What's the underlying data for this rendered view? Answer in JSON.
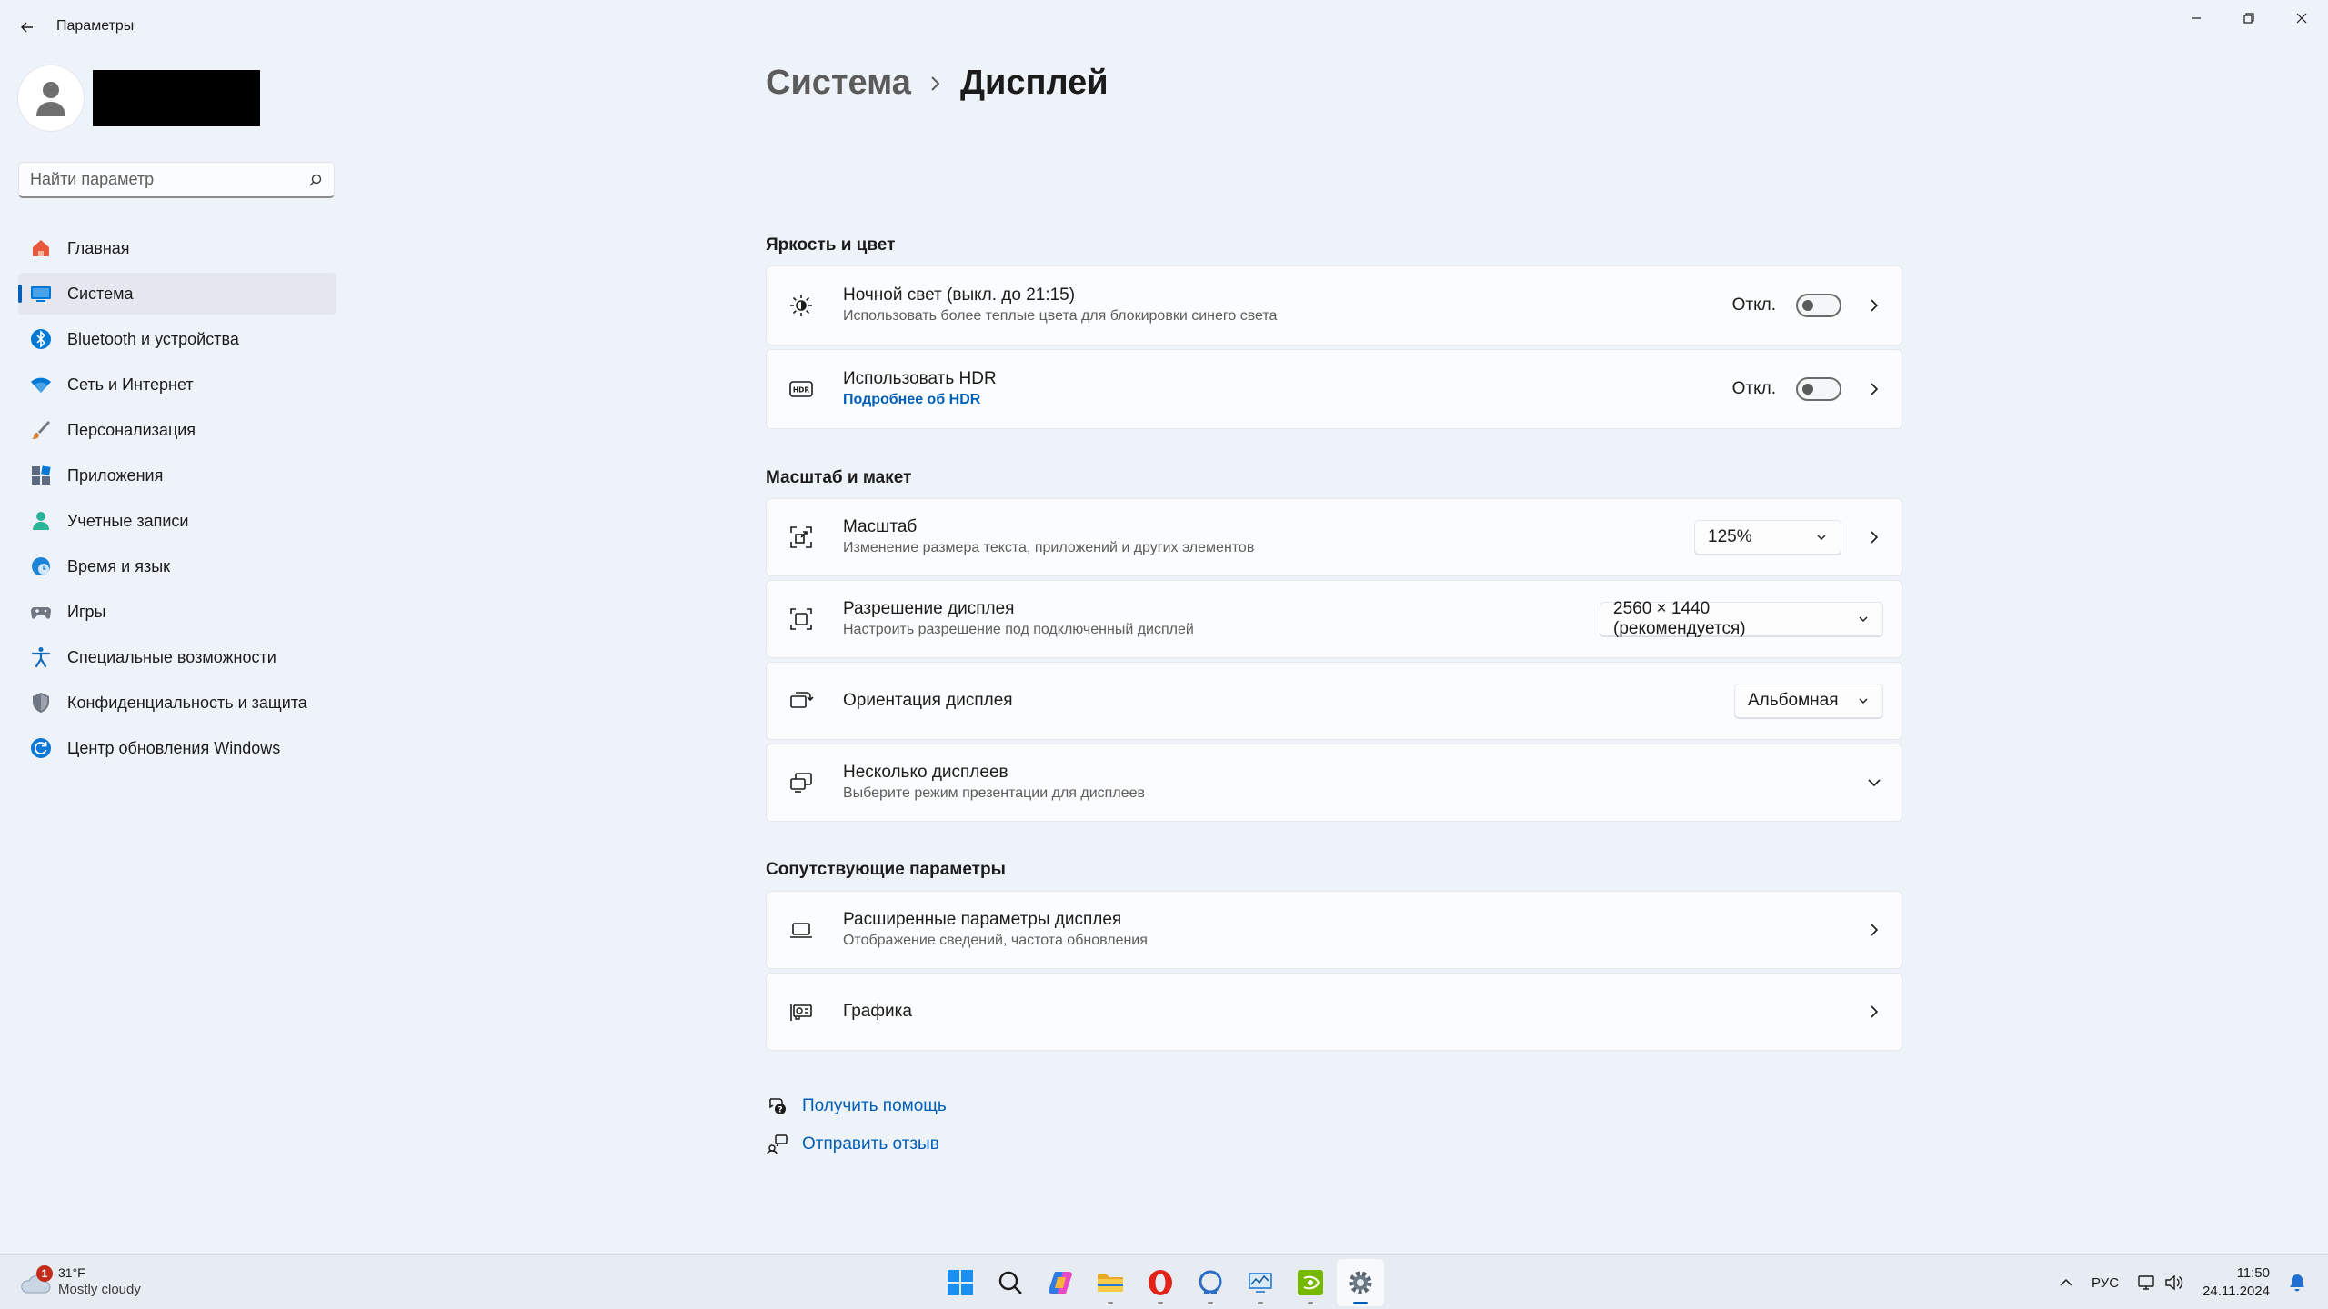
{
  "window": {
    "title": "Параметры",
    "back_icon": "arrow-left-icon",
    "controls": [
      "minimize-icon",
      "restore-icon",
      "close-icon"
    ]
  },
  "search": {
    "placeholder": "Найти параметр",
    "value": ""
  },
  "sidebar": {
    "items": [
      {
        "label": "Главная",
        "icon": "home-icon",
        "color": "#e8593b"
      },
      {
        "label": "Система",
        "icon": "monitor-icon",
        "color": "#0078d4",
        "active": true
      },
      {
        "label": "Bluetooth и устройства",
        "icon": "bluetooth-icon",
        "color": "#0078d4"
      },
      {
        "label": "Сеть и Интернет",
        "icon": "wifi-icon",
        "color": "#0078d4"
      },
      {
        "label": "Персонализация",
        "icon": "brush-icon",
        "color": "#d4823a"
      },
      {
        "label": "Приложения",
        "icon": "apps-icon",
        "color": "#5c6b82"
      },
      {
        "label": "Учетные записи",
        "icon": "person-icon",
        "color": "#2bb49a"
      },
      {
        "label": "Время и язык",
        "icon": "globe-clock-icon",
        "color": "#1b84d6"
      },
      {
        "label": "Игры",
        "icon": "gamepad-icon",
        "color": "#6f7782"
      },
      {
        "label": "Специальные возможности",
        "icon": "accessibility-icon",
        "color": "#0f6cbd"
      },
      {
        "label": "Конфиденциальность и защита",
        "icon": "shield-icon",
        "color": "#6f7782"
      },
      {
        "label": "Центр обновления Windows",
        "icon": "refresh-icon",
        "color": "#0f78d4"
      }
    ]
  },
  "breadcrumb": {
    "parent": "Система",
    "current": "Дисплей"
  },
  "sections": {
    "brightness": {
      "title": "Яркость и цвет",
      "night_light": {
        "title": "Ночной свет (выкл. до 21:15)",
        "subtitle": "Использовать более теплые цвета для блокировки синего света",
        "state": "Откл.",
        "on": false
      },
      "hdr": {
        "title": "Использовать HDR",
        "link": "Подробнее об HDR",
        "state": "Откл.",
        "on": false
      }
    },
    "scale_layout": {
      "title": "Масштаб и макет",
      "scale": {
        "title": "Масштаб",
        "subtitle": "Изменение размера текста, приложений и других элементов",
        "value": "125%"
      },
      "resolution": {
        "title": "Разрешение дисплея",
        "subtitle": "Настроить разрешение под подключенный дисплей",
        "value": "2560 × 1440 (рекомендуется)"
      },
      "orientation": {
        "title": "Ориентация дисплея",
        "value": "Альбомная"
      },
      "multiple": {
        "title": "Несколько дисплеев",
        "subtitle": "Выберите режим презентации для дисплеев"
      }
    },
    "related": {
      "title": "Сопутствующие параметры",
      "advanced": {
        "title": "Расширенные параметры дисплея",
        "subtitle": "Отображение сведений, частота обновления"
      },
      "graphics": {
        "title": "Графика"
      }
    }
  },
  "links": {
    "help": "Получить помощь",
    "feedback": "Отправить отзыв"
  },
  "taskbar": {
    "weather": {
      "temp": "31°F",
      "desc": "Mostly cloudy",
      "badge": "1"
    },
    "apps": [
      "windows-start-icon",
      "search-icon",
      "copilot-icon",
      "file-explorer-icon",
      "opera-icon",
      "app-icon",
      "monitor-chart-icon",
      "nvidia-icon",
      "settings-gear-icon"
    ],
    "lang": "РУС",
    "time": "11:50",
    "date": "24.11.2024"
  },
  "colors": {
    "accent": "#005fb8",
    "background": "#eef3f9",
    "card": "#fbfcfd"
  }
}
